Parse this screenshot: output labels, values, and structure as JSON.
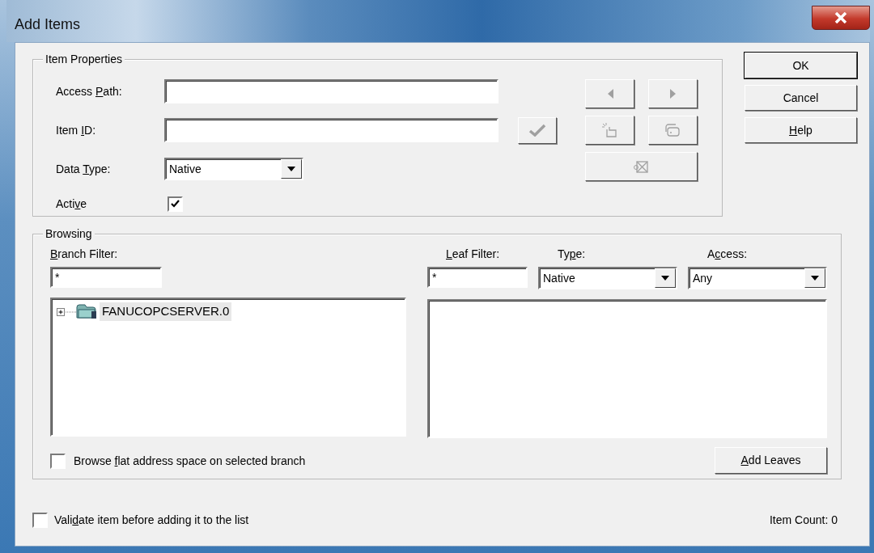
{
  "window": {
    "title": "Add Items"
  },
  "item_properties": {
    "legend": "Item Properties",
    "fields": [
      {
        "kind": "text",
        "label": {
          "pre": "Access ",
          "key": "P",
          "post": "ath:"
        }
      },
      {
        "kind": "text",
        "label": {
          "pre": "Item ",
          "key": "I",
          "post": "D:"
        }
      },
      {
        "kind": "select",
        "label": {
          "pre": "Data ",
          "key": "T",
          "post": "ype:"
        },
        "value": "Native"
      },
      {
        "kind": "checkbox",
        "label": {
          "pre": "Acti",
          "key": "v",
          "post": "e"
        },
        "checked": true
      }
    ],
    "validate_button": {
      "disabled": true
    },
    "tool_buttons": [
      {
        "kind": "left",
        "disabled": true
      },
      {
        "kind": "right",
        "disabled": true
      },
      {
        "kind": "new",
        "disabled": true
      },
      {
        "kind": "copy",
        "disabled": true
      },
      {
        "kind": "delete",
        "disabled": true
      }
    ]
  },
  "buttons": [
    {
      "label": "OK",
      "default": true
    },
    {
      "label": "Cancel",
      "default": false
    },
    {
      "label": {
        "key": "H",
        "post": "elp"
      },
      "default": false
    }
  ],
  "browsing": {
    "legend": "Browsing",
    "branch_filter": {
      "label": {
        "key": "B",
        "post": "ranch Filter:"
      },
      "value": "*"
    },
    "tree": [
      {
        "label": "FANUCOPCSERVER.0",
        "expanded": false,
        "selected": true
      }
    ],
    "leaf_filter": {
      "label": {
        "key": "L",
        "post": "eaf Filter:"
      },
      "value": "*"
    },
    "type": {
      "label": {
        "pre": "Ty",
        "key": "p",
        "post": "e:"
      },
      "value": "Native"
    },
    "access": {
      "label": {
        "pre": "A",
        "key": "c",
        "post": "cess:"
      },
      "value": "Any"
    },
    "flat_browse": {
      "label": {
        "pre": "Browse ",
        "key": "f",
        "post": "lat address space on selected branch"
      },
      "checked": false
    },
    "add_leaves": {
      "label": {
        "key": "A",
        "post": "dd Leaves"
      }
    }
  },
  "footer": {
    "validate": {
      "label": {
        "pre": "Vali",
        "key": "d",
        "post": "ate item before adding it to the list"
      },
      "checked": false
    },
    "item_count": "Item Count: 0"
  }
}
